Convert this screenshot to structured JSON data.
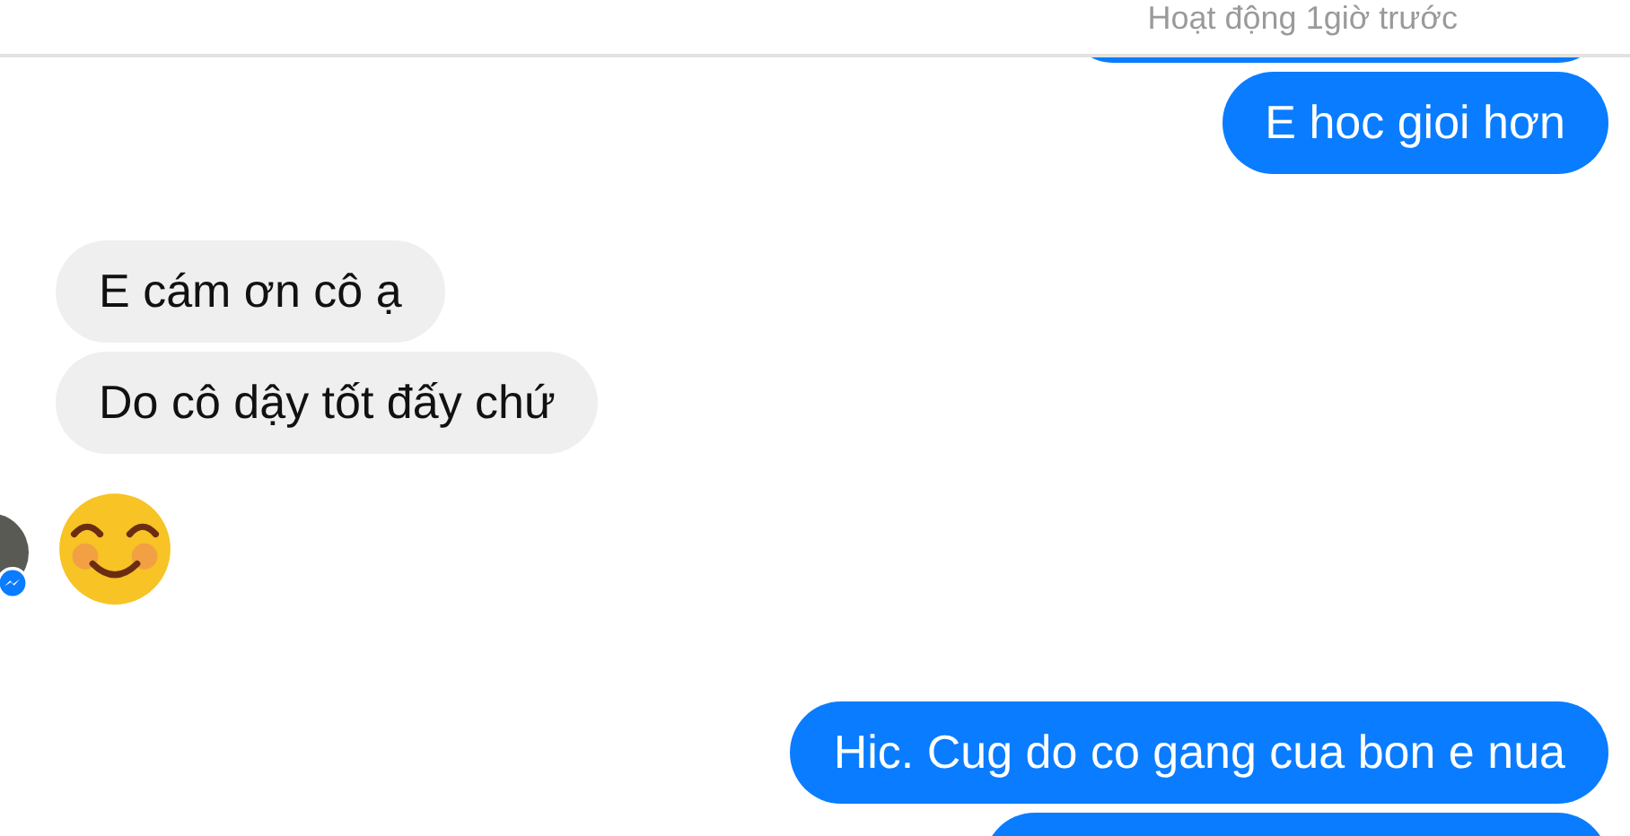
{
  "header": {
    "status": "Hoạt động 1giờ trước"
  },
  "messages": [
    {
      "kind": "sent",
      "text": "E hoc gioi hơn"
    },
    {
      "kind": "received",
      "text": "E cám ơn cô ạ"
    },
    {
      "kind": "received",
      "text": "Do cô dậy tốt đấy chứ"
    },
    {
      "kind": "emoji"
    },
    {
      "kind": "sent",
      "text": "Hic. Cug do co gang cua bon e nua"
    }
  ]
}
